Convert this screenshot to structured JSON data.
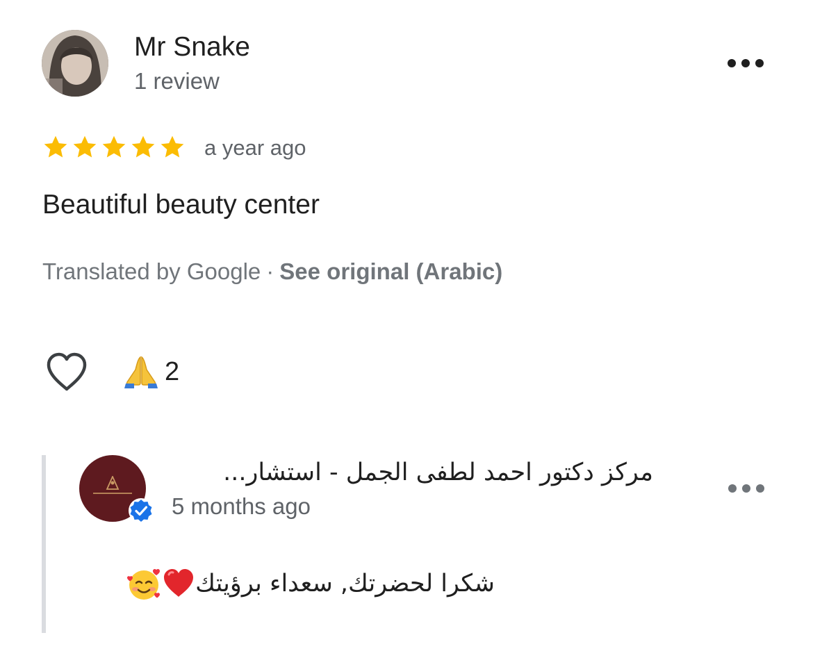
{
  "review": {
    "author_name": "Mr Snake",
    "author_meta": "1 review",
    "rating": 5,
    "rating_max": 5,
    "time": "a year ago",
    "text": "Beautiful beauty center",
    "translated_label": "Translated by Google",
    "separator": "·",
    "see_original_label": "See original (Arabic)",
    "more_icon": "more-horizontal-icon"
  },
  "reactions": {
    "like_icon": "heart-outline-icon",
    "emoji_icon": "folded-hands-icon",
    "count": "2"
  },
  "reply": {
    "owner_name": "مركز دكتور احمد لطفى الجمل - استشار...",
    "time": "5 months ago",
    "text": "شكرا لحضرتك, سعداء برؤيتك",
    "emojis": [
      "red-heart-icon",
      "smiling-face-with-hearts-icon"
    ],
    "verified_icon": "verified-badge-icon",
    "more_icon": "more-horizontal-icon"
  },
  "colors": {
    "star": "#fbbc04",
    "primary_text": "#1f1f1f",
    "secondary_text": "#5f6368",
    "verified": "#1a73e8",
    "reply_bar": "#dadce0",
    "owner_avatar_bg": "#5e1a1f"
  }
}
